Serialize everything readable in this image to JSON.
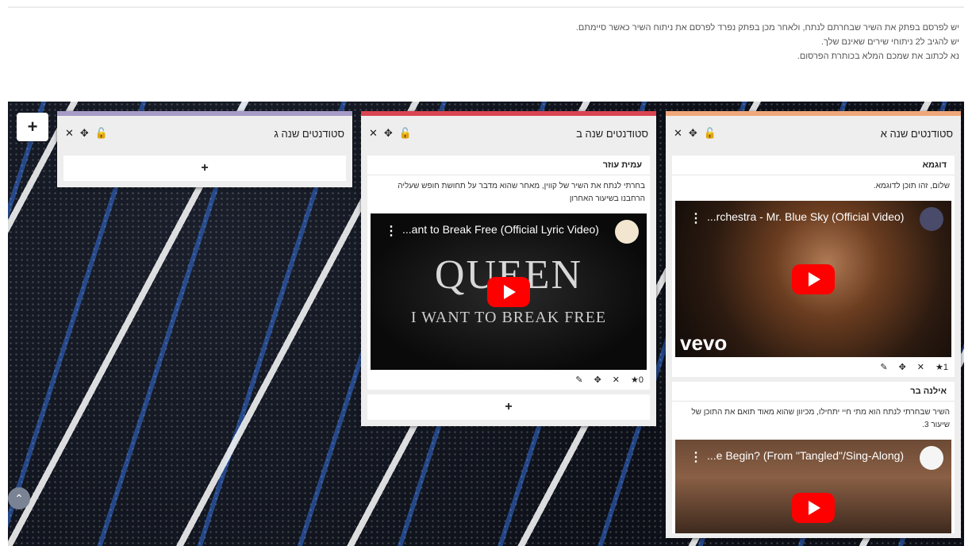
{
  "instructions": [
    "יש לפרסם בפתק את השיר שבחרתם לנתח, ולאחר מכן בפתק נפרד לפרסם את ניתוח השיר כאשר סיימתם.",
    "יש להגיב ל2 ניתוחי שירים שאינם שלך.",
    "נא לכתוב את שמכם המלא בכותרת הפרסום."
  ],
  "board": {
    "add_column": "+",
    "scroll_up": "⌃",
    "add_post": "+",
    "tools": {
      "close": "✕",
      "move": "✥",
      "lock": "🔓"
    },
    "columns": [
      {
        "title": "סטודנטים שנה א",
        "accent": "#f0a77a",
        "posts": [
          {
            "title": "דוגמא",
            "body": "שלום, זהו תוכן לדוגמא.",
            "video_title": "...rchestra - Mr. Blue Sky (Official Video)",
            "video_brand": "vevo",
            "stars": "1"
          },
          {
            "title": "אילנה בר",
            "body": "השיר שבחרתי לנתח הוא מתי חיי יתחילו, מכיוון שהוא מאוד תואם את התוכן של שיעור 3.",
            "video_title": "...e Begin? (From \"Tangled\"/Sing-Along)"
          }
        ]
      },
      {
        "title": "סטודנטים שנה ב",
        "accent": "#d94452",
        "posts": [
          {
            "title": "עמית עוזר",
            "body": "בחרתי לנתח את השיר של קווין, מאחר שהוא מדבר על תחושת חופש שעליה הרחבנו בשיעור האחרון",
            "video_title": "...ant to Break Free (Official Lyric Video)",
            "video_word": "QUEEN",
            "video_sub": "I WANT TO BREAK FREE",
            "stars": "0"
          }
        ]
      },
      {
        "title": "סטודנטים שנה ג",
        "accent": "#a79bc8",
        "posts": []
      }
    ]
  },
  "icons": {
    "edit": "✎",
    "move": "✥",
    "delete": "✕",
    "star": "★",
    "video_menu": "⋮"
  }
}
